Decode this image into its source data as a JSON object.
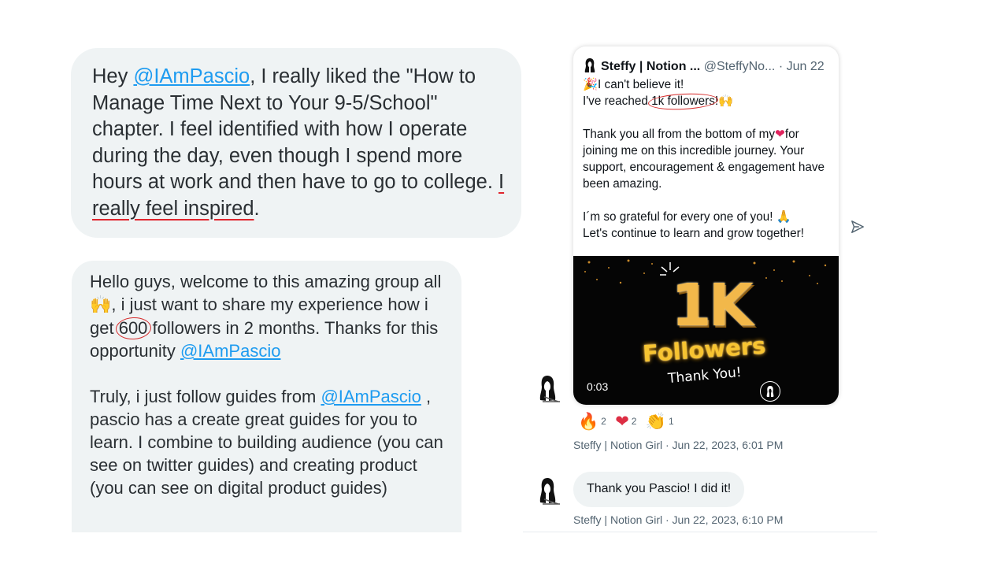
{
  "message1": {
    "before_mention": "Hey ",
    "mention": "@IAmPascio",
    "middle": ", I really liked the \"How to Manage Time Next to Your 9-5/School\" chapter. I feel identified with how I operate during the day, even though I spend more hours at work and then have to go to college. ",
    "highlight": "I really feel inspired",
    "after": "."
  },
  "message2": {
    "p1_a": "Hello guys, welcome to this amazing group all ",
    "p1_emoji": "🙌",
    "p1_b": ", i just want to share my experience how i get ",
    "p1_num": "600",
    "p1_c": " followers in 2 months. Thanks for this opportunity ",
    "p1_mention": "@IAmPascio",
    "p2_a": "Truly, i just follow guides from ",
    "p2_mention": "@IAmPascio",
    "p2_b": " , pascio has a create great guides for you to learn. I combine to building audience (you can see on twitter guides) and creating product (you can see on digital product guides)"
  },
  "tweet": {
    "name": "Steffy | Notion ...",
    "handle": "@SteffyNo...",
    "date": "· Jun 22",
    "line1_emoji": "🎉",
    "line1": "I can't believe it!",
    "line2_a": "I've reached ",
    "line2_circled": "1k followers",
    "line2_b": "!",
    "line2_emoji": "🙌",
    "p2_a": "Thank you all from the bottom of my",
    "p2_heart": "❤",
    "p2_b": "for joining me on this incredible journey. Your support, encouragement & engagement have been amazing.",
    "p3_a": "I´m so grateful for every one of you! ",
    "p3_emoji": "🙏",
    "p3_b": "Let's continue to learn and grow together!",
    "video": {
      "big": "1K",
      "followers": "Followers",
      "thanks": "Thank You!",
      "time": "0:03"
    }
  },
  "reactions": [
    {
      "emoji": "🔥",
      "count": "2",
      "color": "#f4900c"
    },
    {
      "emoji": "❤",
      "count": "2",
      "color": "#dd2e44"
    },
    {
      "emoji": "👏",
      "count": "1",
      "color": "#ffcc4d"
    }
  ],
  "meta1": "Steffy | Notion Girl · Jun 22, 2023, 6:01 PM",
  "reply": "Thank you Pascio! I did it!",
  "meta2": "Steffy | Notion Girl · Jun 22, 2023, 6:10 PM",
  "colors": {
    "bubble": "#eff3f4",
    "mention": "#1d9bf0",
    "annotation": "#e0252e"
  }
}
